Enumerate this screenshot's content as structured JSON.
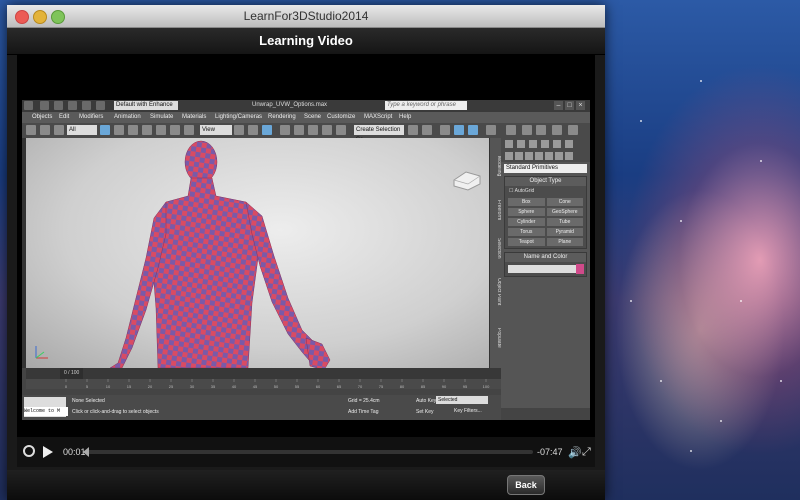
{
  "window": {
    "title": "LearnFor3DStudio2014"
  },
  "header": {
    "title": "Learning Video"
  },
  "max": {
    "workspace": "Default with Enhance",
    "filename": "Unwrap_UVW_Options.max",
    "search_placeholder": "Type a keyword or phrase",
    "menus": [
      "Objects",
      "Edit",
      "Modifiers",
      "Animation",
      "Simulate",
      "Materials",
      "Lighting/Cameras",
      "Rendering",
      "Scene",
      "Customize",
      "MAXScript",
      "Help"
    ],
    "filter": "All",
    "view": "View",
    "selection_set": "Create Selection Se",
    "vtabs": [
      "Modeling",
      "Freeform",
      "Selection",
      "Object Paint",
      "Populate"
    ],
    "cmd_dropdown": "Standard Primitives",
    "object_type_title": "Object Type",
    "autogrid_label": "AutoGrid",
    "object_buttons": [
      "Box",
      "Cone",
      "Sphere",
      "GeoSphere",
      "Cylinder",
      "Tube",
      "Torus",
      "Pyramid",
      "Teapot",
      "Plane"
    ],
    "name_color_title": "Name and Color",
    "timeline": "0 / 100",
    "track_ticks": [
      "0",
      "5",
      "10",
      "15",
      "20",
      "25",
      "30",
      "35",
      "40",
      "45",
      "50",
      "55",
      "60",
      "65",
      "70",
      "75",
      "80",
      "85",
      "90",
      "95",
      "100"
    ],
    "status": {
      "welcome": "Welcome to M",
      "selection": "None Selected",
      "prompt": "Click or click-and-drag to select objects",
      "grid": "Grid = 25.4cm",
      "add_time_tag": "Add Time Tag",
      "auto_key": "Auto Key",
      "auto_key_value": "Selected",
      "set_key": "Set Key",
      "key_filters": "Key Filters..."
    }
  },
  "player": {
    "elapsed": "00:01",
    "remaining": "-07:47",
    "progress": 0.002
  },
  "footer": {
    "back_label": "Back"
  }
}
